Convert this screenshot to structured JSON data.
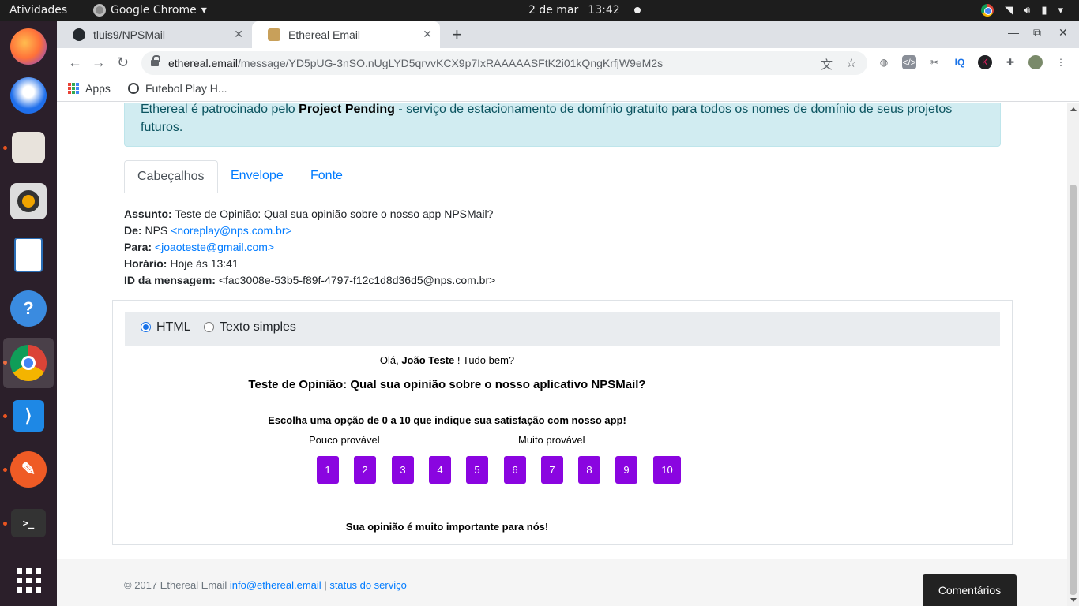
{
  "system": {
    "activities": "Atividades",
    "app_name": "Google Chrome",
    "date": "2 de mar",
    "time": "13:42"
  },
  "dock": {
    "items": [
      "firefox-icon",
      "thunderbird-icon",
      "files-icon",
      "rhythmbox-icon",
      "libreoffice-writer-icon",
      "help-icon",
      "chrome-icon",
      "vscode-icon",
      "postman-icon",
      "terminal-icon",
      "show-apps-icon"
    ]
  },
  "browser": {
    "tabs": [
      {
        "title": "tluis9/NPSMail"
      },
      {
        "title": "Ethereal Email"
      }
    ],
    "url_host": "ethereal.email",
    "url_path": "/message/YD5pUG-3nSO.nUgLYD5qrvvKCX9p7IxRAAAAASFtK2i01kQngKrfjW9eM2s",
    "bookmarks": [
      {
        "label": "Apps"
      },
      {
        "label": "Futebol Play H..."
      }
    ]
  },
  "page": {
    "alert_prefix": "Ethereal é patrocinado pelo ",
    "alert_bold": "Project Pending",
    "alert_suffix": " - serviço de estacionamento de domínio gratuito para todos os nomes de domínio de seus projetos futuros.",
    "tabs": [
      "Cabeçalhos",
      "Envelope",
      "Fonte"
    ],
    "headers": {
      "subject_label": "Assunto:",
      "subject": "Teste de Opinião: Qual sua opinião sobre o nosso app NPSMail?",
      "from_label": "De:",
      "from_name": "NPS",
      "from_email": "<noreplay@nps.com.br>",
      "to_label": "Para:",
      "to_email": "<joaoteste@gmail.com>",
      "time_label": "Horário:",
      "time": "Hoje às 13:41",
      "id_label": "ID da mensagem:",
      "id": "<fac3008e-53b5-f89f-4797-f12c1d8d36d5@nps.com.br>"
    },
    "view_options": {
      "html": "HTML",
      "plain": "Texto simples",
      "selected": "HTML"
    },
    "email": {
      "greeting_pre": "Olá, ",
      "greeting_name": "João Teste",
      "greeting_post": " ! Tudo bem?",
      "title": "Teste de Opinião: Qual sua opinião sobre o nosso aplicativo NPSMail?",
      "instruction": "Escolha uma opção de 0 a 10 que indique sua satisfação com nosso app!",
      "low_label": "Pouco provável",
      "high_label": "Muito provável",
      "scores": [
        "1",
        "2",
        "3",
        "4",
        "5",
        "6",
        "7",
        "8",
        "9",
        "10"
      ],
      "closing": "Sua opinião é muito importante para nós!",
      "button_color": "#8a05e0"
    },
    "footer": {
      "copyright": "© 2017 Ethereal Email ",
      "email": "info@ethereal.email",
      "separator": " | ",
      "status": "status do serviço"
    },
    "feedback": "Comentários"
  }
}
